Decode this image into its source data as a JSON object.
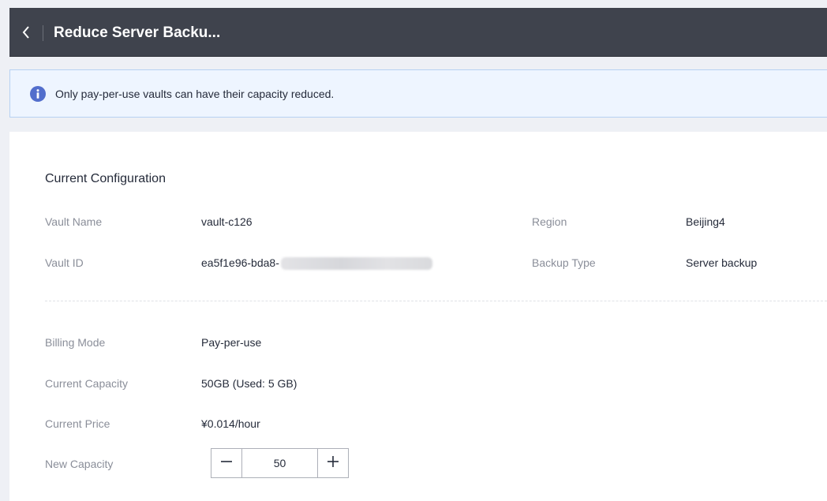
{
  "header": {
    "title": "Reduce Server Backu..."
  },
  "alert": {
    "text": "Only pay-per-use vaults can have their capacity reduced.",
    "icon": "info-icon",
    "accent_color": "#526ecc"
  },
  "current_configuration": {
    "title": "Current Configuration",
    "vault_name_label": "Vault Name",
    "vault_name": "vault-c126",
    "region_label": "Region",
    "region": "Beijing4",
    "vault_id_label": "Vault ID",
    "vault_id_visible": "ea5f1e96-bda8-",
    "backup_type_label": "Backup Type",
    "backup_type": "Server backup"
  },
  "billing": {
    "billing_mode_label": "Billing Mode",
    "billing_mode": "Pay-per-use",
    "current_capacity_label": "Current Capacity",
    "current_capacity": "50GB (Used: 5 GB)",
    "current_price_label": "Current Price",
    "current_price": "¥0.014/hour",
    "new_capacity_label": "New Capacity",
    "new_capacity_value": "50"
  },
  "colors": {
    "header_bg": "#3f434d",
    "alert_bg": "#eef5ff",
    "alert_border": "#b7d1f2"
  }
}
